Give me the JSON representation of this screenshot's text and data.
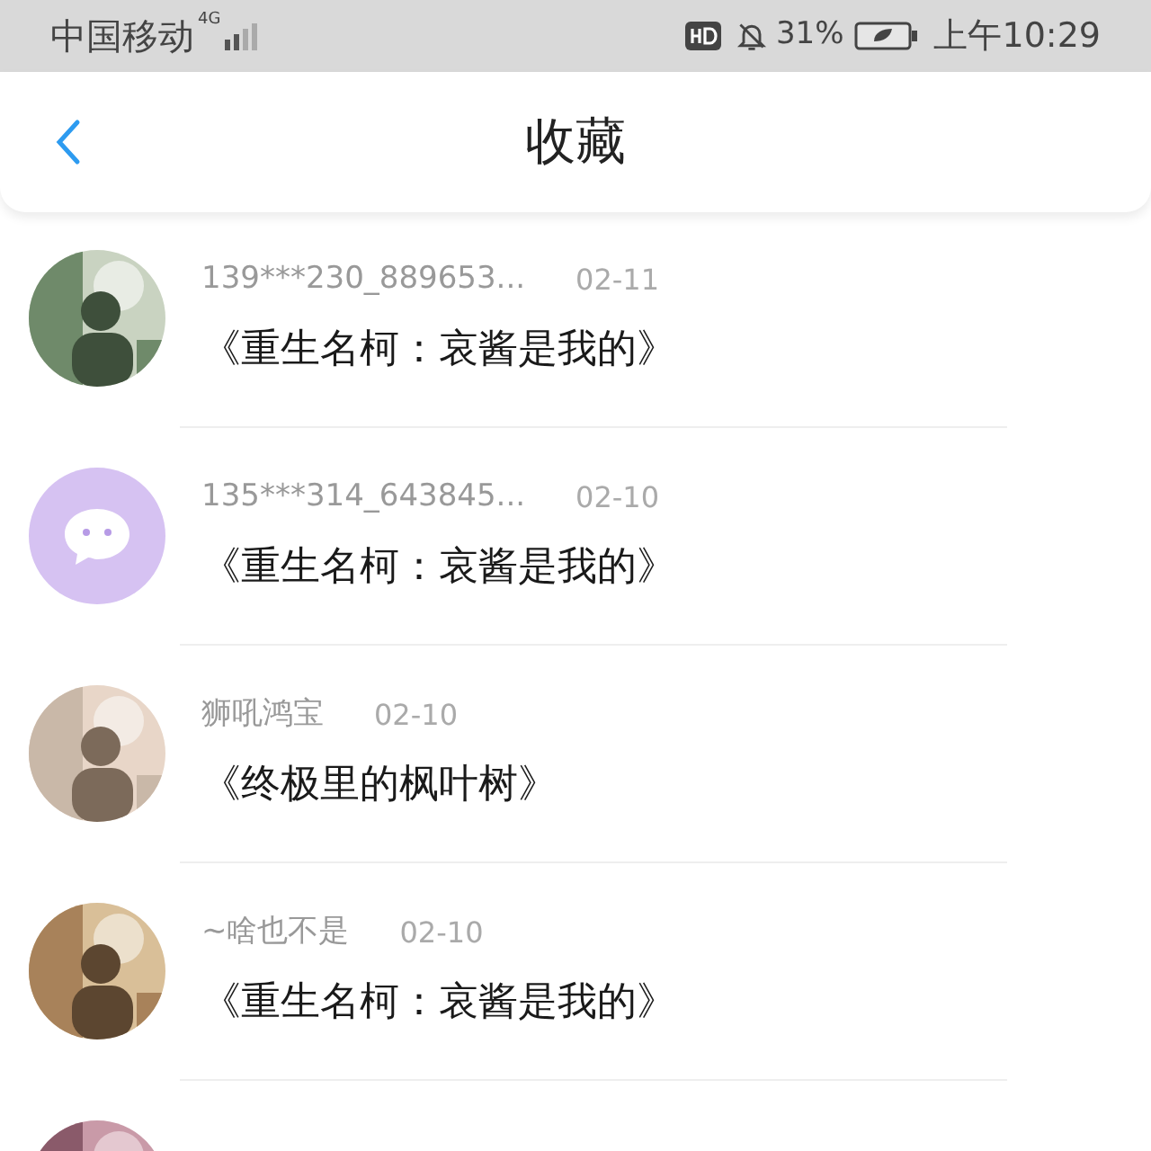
{
  "status_bar": {
    "carrier": "中国移动",
    "network": "4G",
    "battery_percent": "31%",
    "time": "上午10:29"
  },
  "header": {
    "title": "收藏"
  },
  "items": [
    {
      "avatar": {
        "kind": "picture"
      },
      "name": "139***230_889653...",
      "date": "02-11",
      "title": "《重生名柯：哀酱是我的》"
    },
    {
      "avatar": {
        "kind": "default"
      },
      "name": "135***314_643845...",
      "date": "02-10",
      "title": "《重生名柯：哀酱是我的》"
    },
    {
      "avatar": {
        "kind": "picture"
      },
      "name": "狮吼鸿宝",
      "date": "02-10",
      "title": "《终极里的枫叶树》"
    },
    {
      "avatar": {
        "kind": "picture"
      },
      "name": "~啥也不是",
      "date": "02-10",
      "title": "《重生名柯：哀酱是我的》"
    },
    {
      "avatar": {
        "kind": "picture"
      }
    }
  ]
}
